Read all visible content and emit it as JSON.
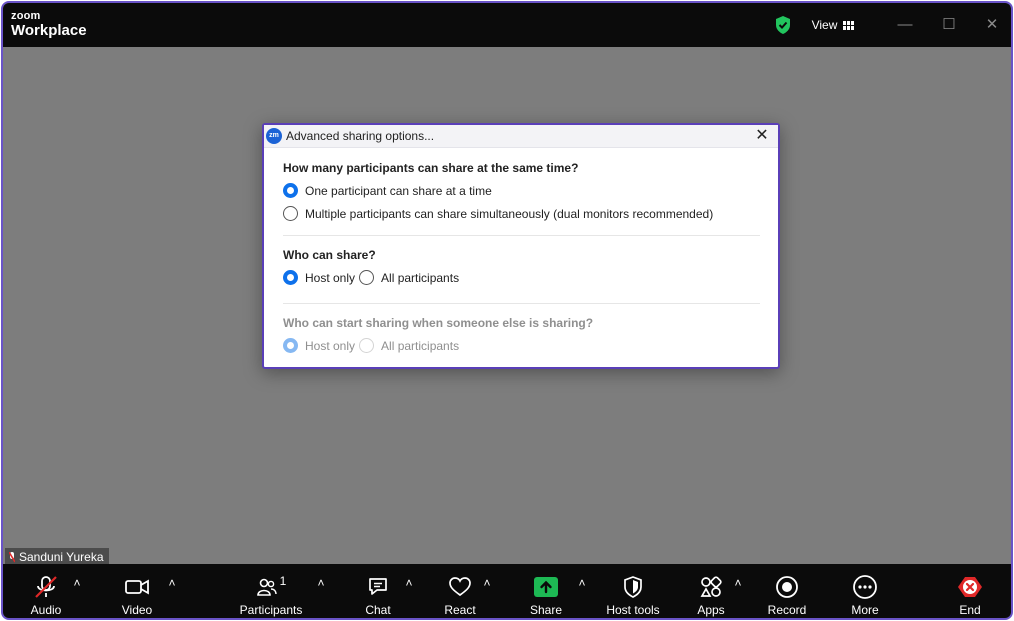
{
  "app": {
    "brand_small": "zoom",
    "brand_name": "Workplace"
  },
  "titlebar": {
    "view_label": "View"
  },
  "dialog": {
    "logo": "zm",
    "title": "Advanced sharing options...",
    "q1": {
      "question": "How many participants can share at the same time?",
      "options": [
        "One participant can share at a time",
        "Multiple participants can share simultaneously (dual monitors recommended)"
      ],
      "selected": 0
    },
    "q2": {
      "question": "Who can share?",
      "options": [
        "Host only",
        "All participants"
      ],
      "selected": 0
    },
    "q3": {
      "question": "Who can start sharing when someone else is sharing?",
      "options": [
        "Host only",
        "All participants"
      ],
      "selected": 0,
      "disabled": true
    }
  },
  "participant_tag": {
    "name": "Sanduni Yureka"
  },
  "toolbar": {
    "audio": "Audio",
    "video": "Video",
    "participants": "Participants",
    "participants_count": "1",
    "chat": "Chat",
    "react": "React",
    "share": "Share",
    "host_tools": "Host tools",
    "apps": "Apps",
    "record": "Record",
    "more": "More",
    "end": "End"
  },
  "colors": {
    "accent": "#0e71eb",
    "share_green": "#1db954",
    "end_red": "#e02828",
    "shield_green": "#22c55e"
  }
}
